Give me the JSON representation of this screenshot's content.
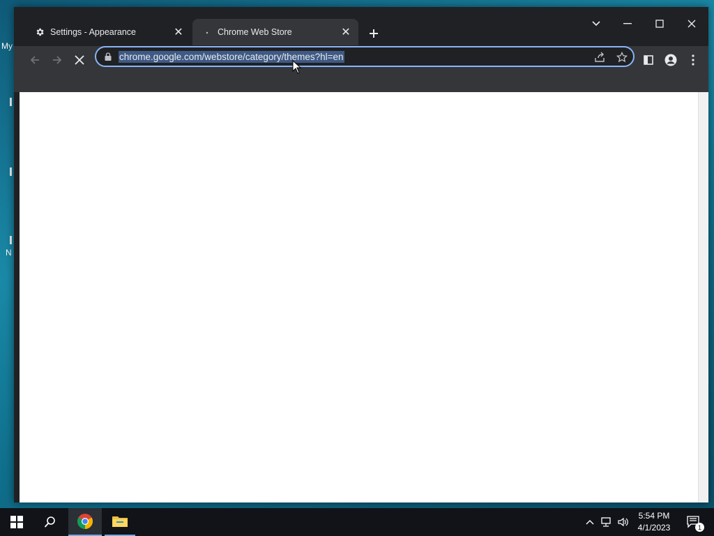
{
  "desktop": {
    "labels": [
      "My",
      "N"
    ]
  },
  "browser": {
    "tabs": [
      {
        "title": "Settings - Appearance",
        "icon": "gear-icon",
        "active": false
      },
      {
        "title": "Chrome Web Store",
        "icon": "loading-dot-icon",
        "active": true
      }
    ],
    "address": {
      "url": "chrome.google.com/webstore/category/themes?hl=en"
    }
  },
  "taskbar": {
    "time": "5:54 PM",
    "date": "4/1/2023",
    "notification_count": "1"
  }
}
